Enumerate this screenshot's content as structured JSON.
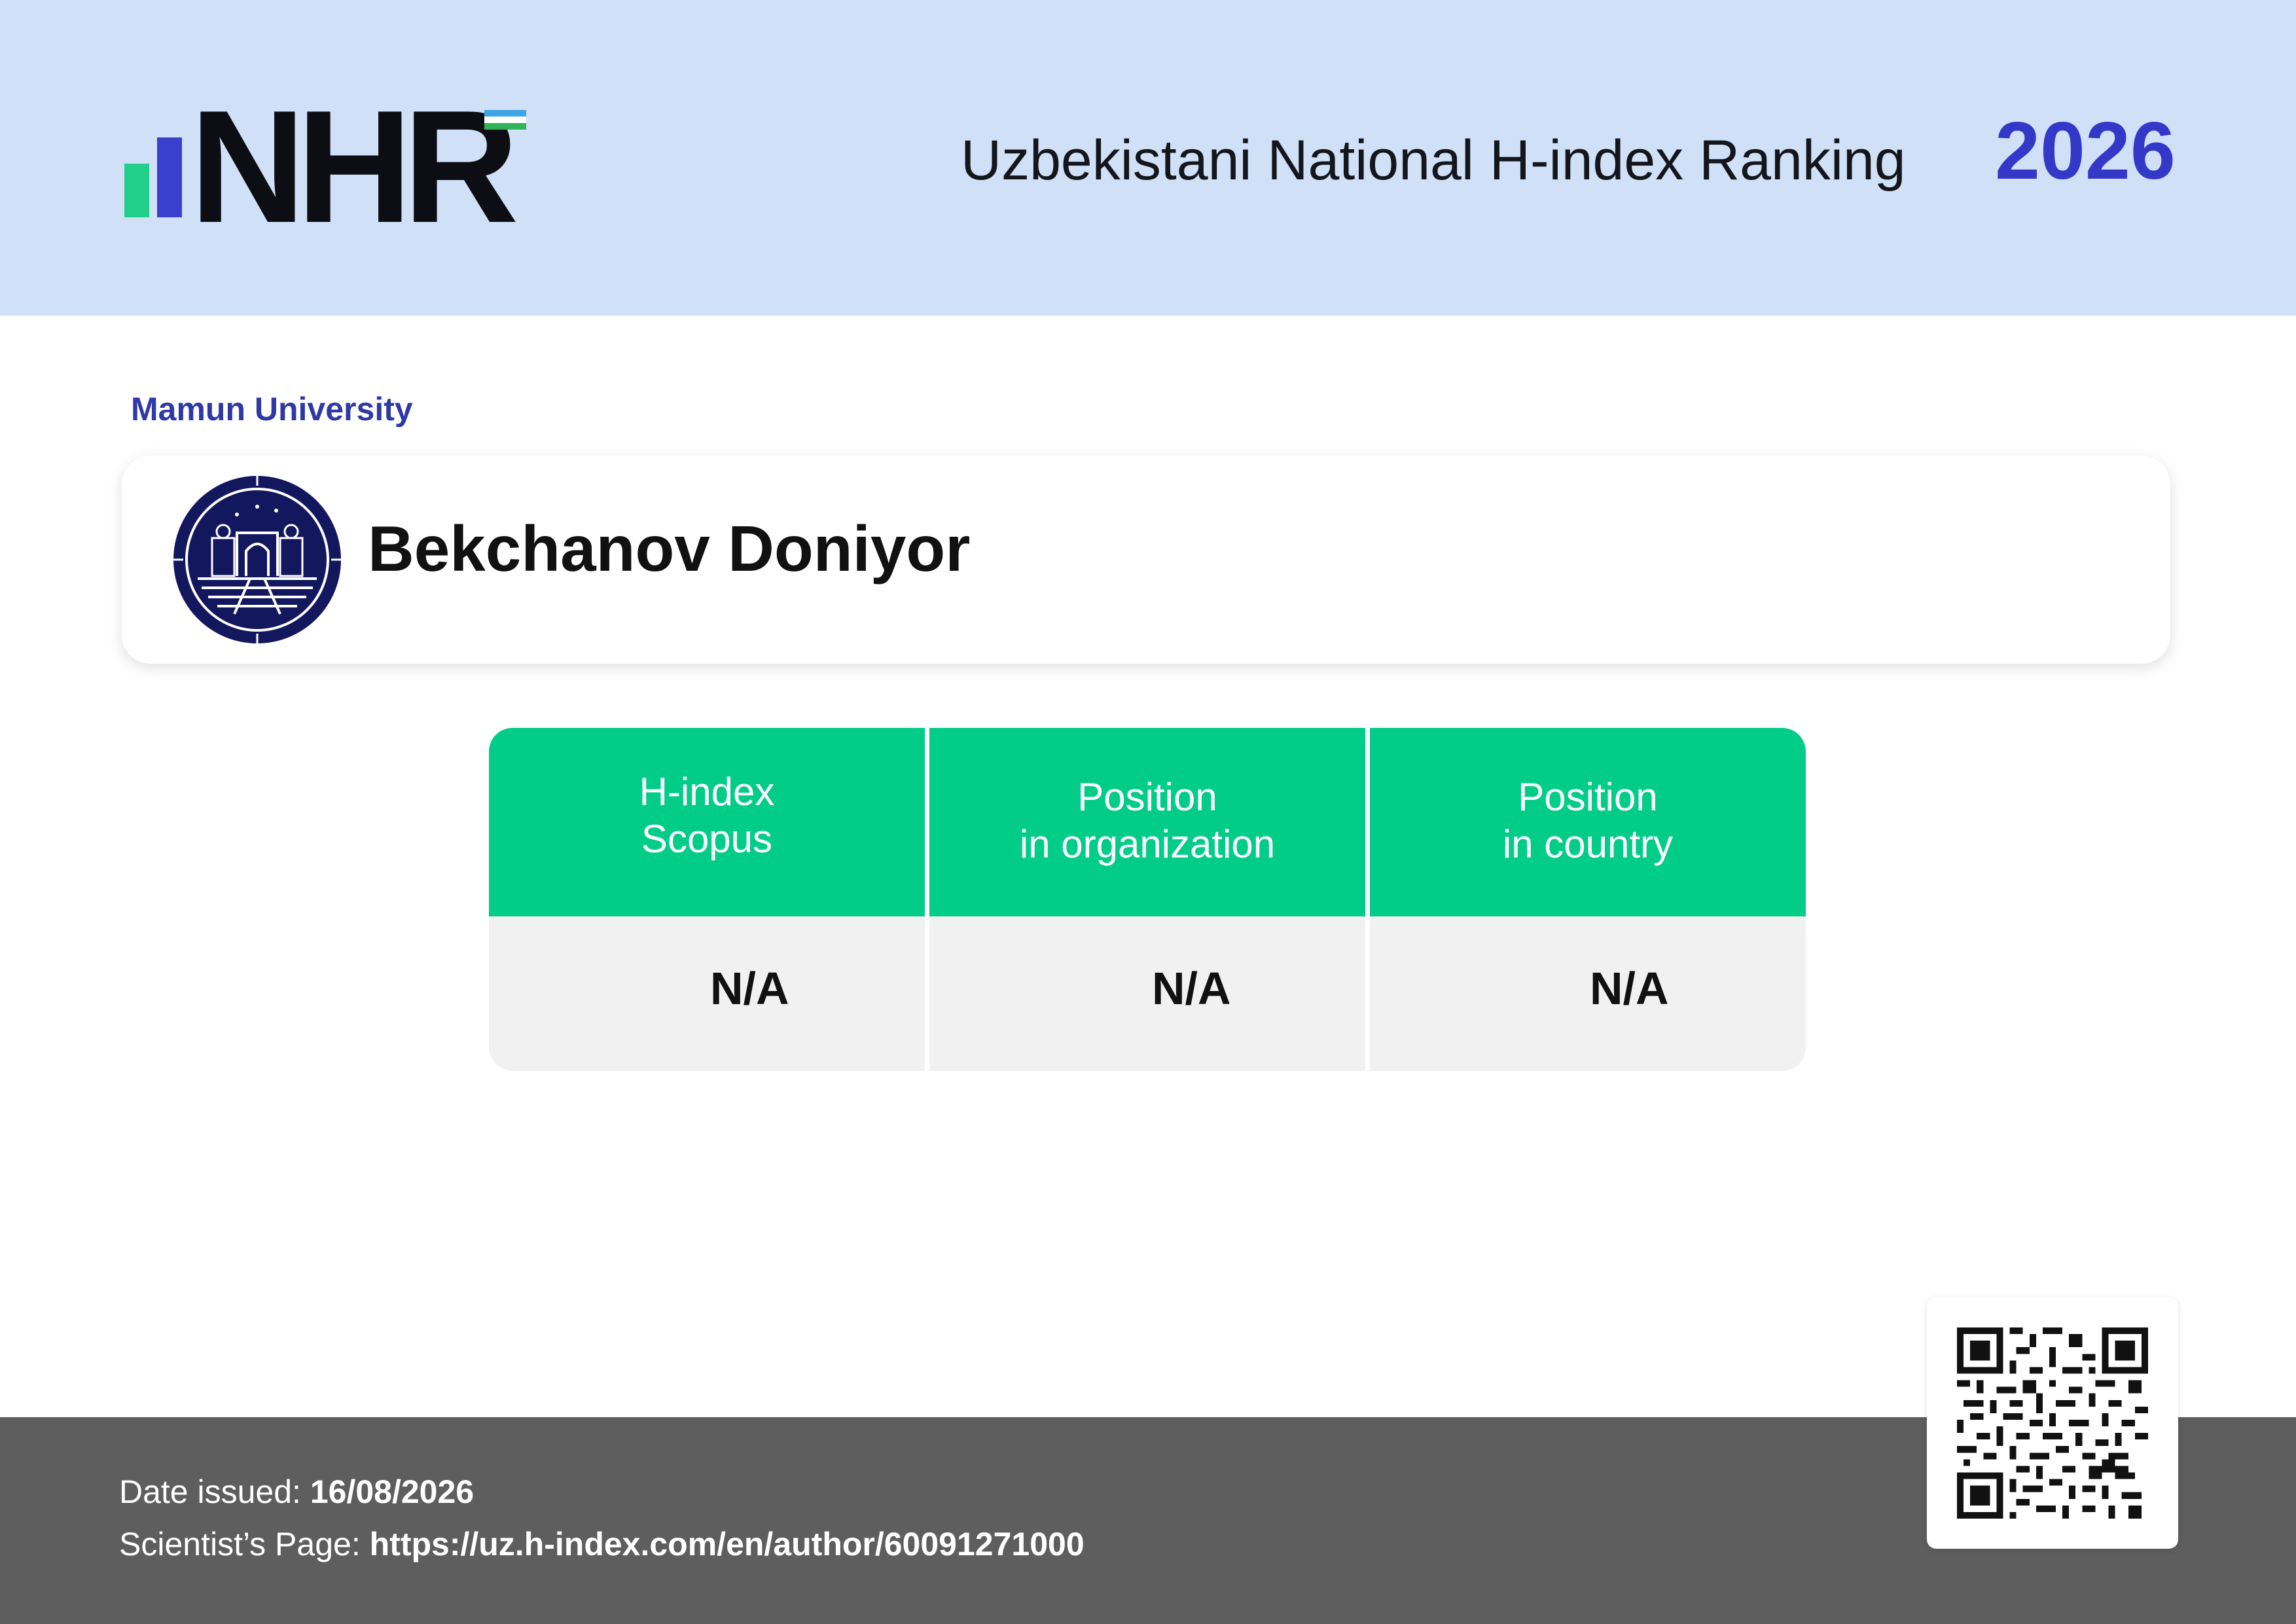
{
  "header": {
    "logo_text": "NHR",
    "title": "Uzbekistani National H-index Ranking",
    "year": "2026"
  },
  "affiliation": "Mamun University",
  "scientist": {
    "name": "Bekchanov Doniyor",
    "org_logo_icon": "university-emblem-icon"
  },
  "stats": {
    "columns": [
      {
        "header_line1": "H-index",
        "header_line2": "Scopus",
        "value": "N/A"
      },
      {
        "header_line1": "Position",
        "header_line2": "in organization",
        "value": "N/A"
      },
      {
        "header_line1": "Position",
        "header_line2": "in country",
        "value": "N/A"
      }
    ]
  },
  "footer": {
    "date_label": "Date issued:",
    "date_value": "16/08/2026",
    "page_label": "Scientist’s Page:",
    "page_url": "https://uz.h-index.com/en/author/60091271000"
  },
  "colors": {
    "header_bg": "#cfe0f7",
    "accent_blue": "#3438c9",
    "accent_green": "#02cd88",
    "footer_bg": "#5e5e5e"
  },
  "icons": [
    "nhr-logo-icon",
    "uzbekistan-flag-icon",
    "university-emblem-icon",
    "qr-code-icon"
  ]
}
